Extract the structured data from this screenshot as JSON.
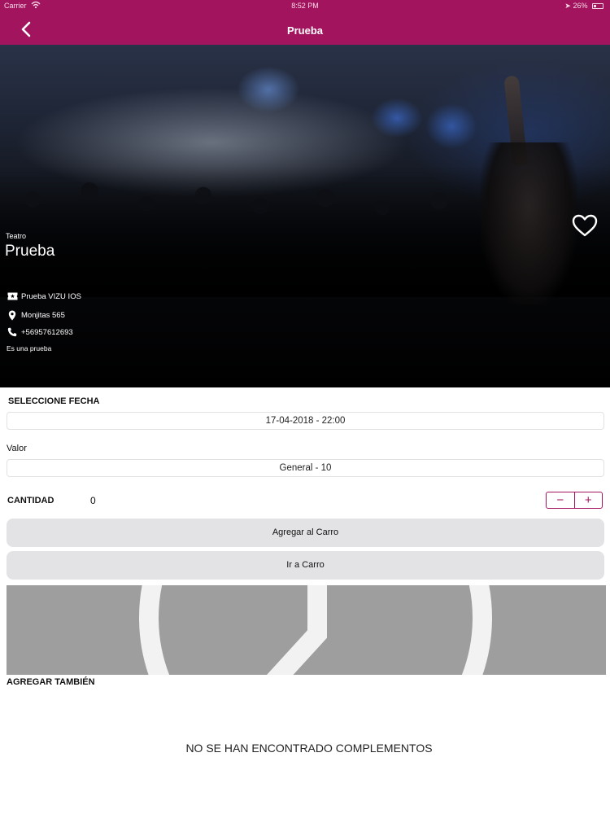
{
  "status_bar": {
    "carrier": "Carrier",
    "time": "8:52 PM",
    "battery": "26%"
  },
  "nav": {
    "title": "Prueba",
    "back_icon": "chevron-left-icon"
  },
  "event": {
    "category": "Teatro",
    "title": "Prueba",
    "venue": "Prueba VIZU IOS",
    "address": "Monjitas 565",
    "phone": "+56957612693",
    "description": "Es una prueba",
    "favorite_icon": "heart-outline-icon"
  },
  "purchase": {
    "date_label": "SELECCIONE FECHA",
    "date_value": "17-04-2018 - 22:00",
    "price_label": "Valor",
    "price_value": "General - 10",
    "quantity_label": "CANTIDAD",
    "quantity_value": "0",
    "decrement_symbol": "−",
    "increment_symbol": "+",
    "add_to_cart_label": "Agregar al Carro",
    "go_to_cart_label": "Ir a Carro"
  },
  "complements": {
    "label": "AGREGAR TAMBIÉN",
    "empty_message": "NO SE HAN ENCONTRADO COMPLEMENTOS"
  },
  "colors": {
    "brand": "#a3145f",
    "button_bg": "#e3e3e5",
    "placeholder_bg": "#9e9e9e"
  }
}
